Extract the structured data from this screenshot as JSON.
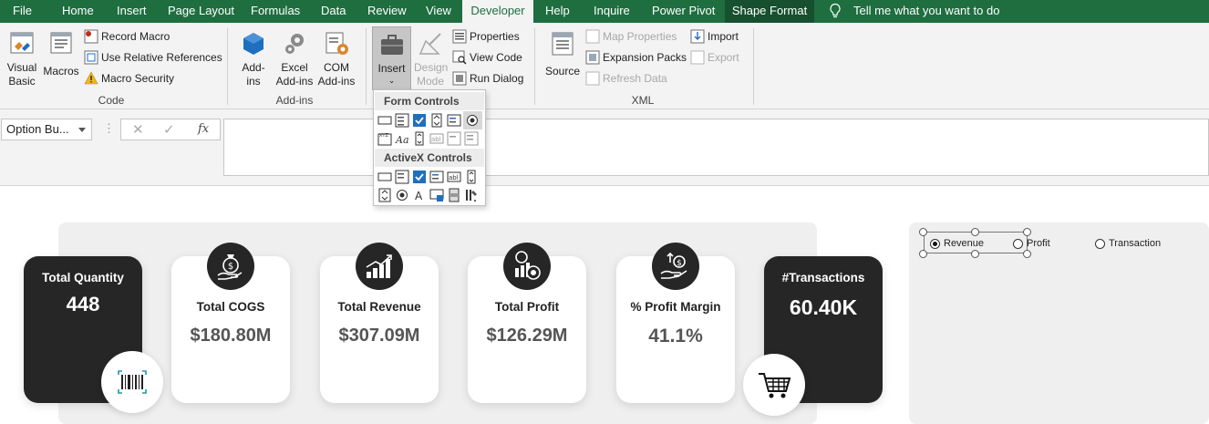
{
  "tabs": [
    {
      "label": "File"
    },
    {
      "label": "Home"
    },
    {
      "label": "Insert"
    },
    {
      "label": "Page Layout"
    },
    {
      "label": "Formulas"
    },
    {
      "label": "Data"
    },
    {
      "label": "Review"
    },
    {
      "label": "View"
    },
    {
      "label": "Developer"
    },
    {
      "label": "Help"
    },
    {
      "label": "Inquire"
    },
    {
      "label": "Power Pivot"
    },
    {
      "label": "Shape Format"
    }
  ],
  "tell_me": "Tell me what you want to do",
  "ribbon": {
    "code": {
      "visual_basic": "Visual Basic",
      "macros": "Macros",
      "record_macro": "Record Macro",
      "use_relative": "Use Relative References",
      "macro_security": "Macro Security",
      "label": "Code"
    },
    "addins": {
      "addins": "Add-ins",
      "excel_addins": "Excel Add-ins",
      "com_addins": "COM Add-ins",
      "label": "Add-ins"
    },
    "controls": {
      "insert": "Insert",
      "design_mode": "Design Mode",
      "properties": "Properties",
      "view_code": "View Code",
      "run_dialog": "Run Dialog"
    },
    "xml": {
      "source": "Source",
      "map_properties": "Map Properties",
      "expansion_packs": "Expansion Packs",
      "refresh_data": "Refresh Data",
      "import": "Import",
      "export": "Export",
      "label": "XML"
    }
  },
  "dropdown": {
    "form_controls": "Form Controls",
    "activex_controls": "ActiveX Controls"
  },
  "formula_bar": {
    "name_box": "Option Bu...",
    "fx": "fx"
  },
  "dashboard": {
    "cards": [
      {
        "title": "Total Quantity",
        "value": "448"
      },
      {
        "title": "Total COGS",
        "value": "$180.80M"
      },
      {
        "title": "Total Revenue",
        "value": "$307.09M"
      },
      {
        "title": "Total Profit",
        "value": "$126.29M"
      },
      {
        "title": "% Profit Margin",
        "value": "41.1%"
      },
      {
        "title": "#Transactions",
        "value": "60.40K"
      }
    ],
    "options": [
      {
        "label": "Revenue",
        "selected": true
      },
      {
        "label": "Profit",
        "selected": false
      },
      {
        "label": "Transaction",
        "selected": false
      }
    ]
  },
  "colors": {
    "excel_green": "#1e6e40",
    "card_dark": "#262626",
    "panel_bg": "#efefef"
  }
}
